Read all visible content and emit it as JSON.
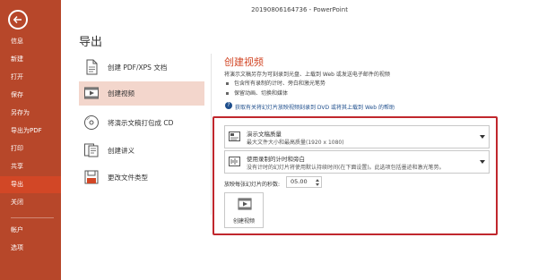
{
  "window": {
    "title": "20190806164736 - PowerPoint"
  },
  "sidebar": {
    "items": [
      {
        "label": "信息",
        "active": false
      },
      {
        "label": "新建",
        "active": false
      },
      {
        "label": "打开",
        "active": false
      },
      {
        "label": "保存",
        "active": false
      },
      {
        "label": "另存为",
        "active": false
      },
      {
        "label": "导出为PDF",
        "active": false
      },
      {
        "label": "打印",
        "active": false
      },
      {
        "label": "共享",
        "active": false
      },
      {
        "label": "导出",
        "active": true
      },
      {
        "label": "关闭",
        "active": false
      },
      {
        "label": "帐户",
        "active": false
      },
      {
        "label": "选项",
        "active": false
      }
    ]
  },
  "page": {
    "title": "导出"
  },
  "options": [
    {
      "label": "创建 PDF/XPS 文档",
      "icon": "pdf-doc-icon",
      "selected": false
    },
    {
      "label": "创建视频",
      "icon": "video-icon",
      "selected": true
    },
    {
      "label": "将演示文稿打包成 CD",
      "icon": "cd-icon",
      "selected": false
    },
    {
      "label": "创建讲义",
      "icon": "handout-icon",
      "selected": false
    },
    {
      "label": "更改文件类型",
      "icon": "file-type-icon",
      "selected": false
    }
  ],
  "panel": {
    "title": "创建视频",
    "description": "将演示文稿另存为可刻录到光盘、上载到 Web 或发送电子邮件的视频",
    "bullets": [
      "包含所有录制的计时、旁白和激光笔势",
      "保留动画、切换和媒体"
    ],
    "help_link": "获取有关将幻灯片放映视频刻录到 DVD 或将其上载到 Web 的帮助",
    "quality": {
      "title": "演示文稿质量",
      "subtitle": "最大文件大小和最高质量(1920 x 1080)"
    },
    "narration": {
      "title": "使用录制的计时和旁白",
      "subtitle": "没有计时的幻灯片将使用默认持续时间(在下面设置)。此选项包括墨迹和激光笔势。"
    },
    "seconds_label": "放映每张幻灯片的秒数:",
    "seconds_value": "05.00",
    "create_button": "创建视频"
  },
  "colors": {
    "sidebar": "#b7472a",
    "sidebar_active": "#d24726",
    "accent": "#d24726",
    "highlight_box": "#c0272d",
    "selected_option": "#f3d6cc"
  }
}
